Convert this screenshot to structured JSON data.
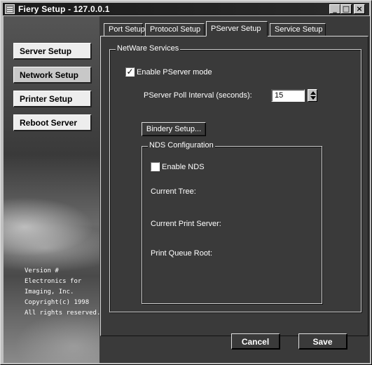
{
  "window": {
    "title": "Fiery Setup - 127.0.0.1"
  },
  "titlebar_buttons": {
    "minimize": "_",
    "maximize": "□",
    "close": "×"
  },
  "sidebar": {
    "items": [
      {
        "label": "Server Setup",
        "active": false
      },
      {
        "label": "Network Setup",
        "active": true
      },
      {
        "label": "Printer Setup",
        "active": false
      },
      {
        "label": "Reboot Server",
        "active": false
      }
    ],
    "version_lines": [
      "Version #",
      "Electronics for",
      "Imaging, Inc.",
      "Copyright(c) 1998",
      "All rights reserved."
    ]
  },
  "tabs": [
    {
      "label": "Port Setup",
      "active": false
    },
    {
      "label": "Protocol Setup",
      "active": false
    },
    {
      "label": "PServer Setup",
      "active": true
    },
    {
      "label": "Service Setup",
      "active": false
    }
  ],
  "netware": {
    "group_title": "NetWare Services",
    "enable_pserver_label": "Enable PServer mode",
    "enable_pserver_checked": true,
    "poll_interval_label": "PServer Poll Interval (seconds):",
    "poll_interval_value": "15",
    "bindery_button": "Bindery Setup..."
  },
  "nds": {
    "group_title": "NDS Configuration",
    "enable_nds_label": "Enable NDS",
    "enable_nds_checked": false,
    "current_tree_label": "Current Tree:",
    "current_print_server_label": "Current Print Server:",
    "print_queue_root_label": "Print Queue Root:"
  },
  "footer": {
    "cancel": "Cancel",
    "save": "Save"
  },
  "colors": {
    "titlebar": "#1a1a1a",
    "panel_bg": "#3a3a3a",
    "chrome": "#c0c0c0",
    "nav_button": "#ededed"
  }
}
